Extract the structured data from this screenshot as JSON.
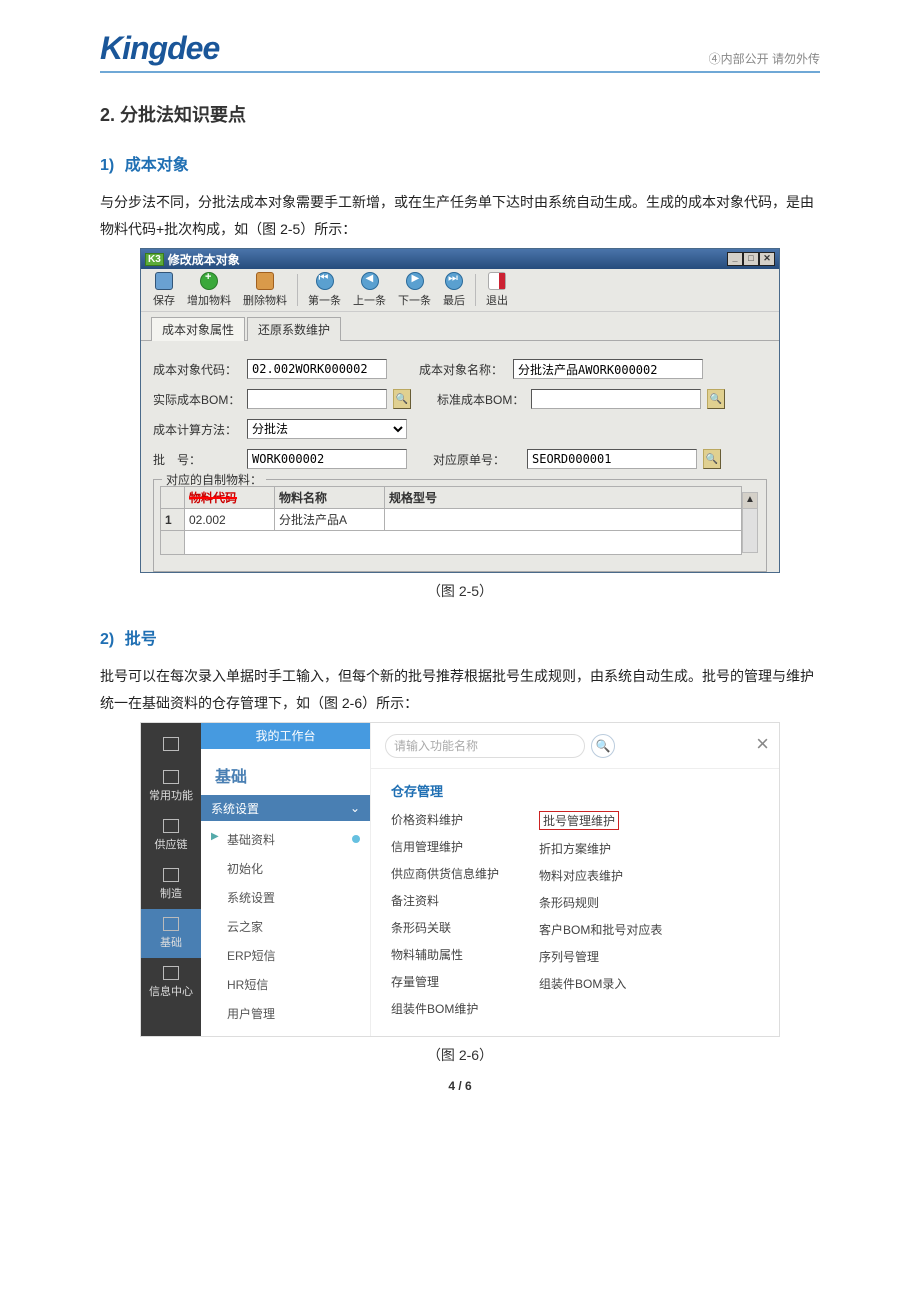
{
  "header": {
    "logo": "Kingdee",
    "confidential": "④内部公开 请勿外传"
  },
  "section": {
    "num": "2.",
    "title": "分批法知识要点"
  },
  "sub1": {
    "num": "1)",
    "title": "成本对象",
    "para": "与分步法不同，分批法成本对象需要手工新增，或在生产任务单下达时由系统自动生成。生成的成本对象代码，是由物料代码+批次构成，如（图 2-5）所示："
  },
  "fig25": {
    "caption": "（图 2-5）",
    "window_title": "修改成本对象",
    "k3": "K3",
    "winbtns": {
      "min": "_",
      "max": "□",
      "close": "✕"
    },
    "toolbar": {
      "save": "保存",
      "add": "增加物料",
      "del": "删除物料",
      "first": "第一条",
      "prev": "上一条",
      "next": "下一条",
      "last": "最后",
      "exit": "退出"
    },
    "tabs": {
      "t1": "成本对象属性",
      "t2": "还原系数维护"
    },
    "form": {
      "code_label": "成本对象代码：",
      "code_value": "02.002WORK000002",
      "name_label": "成本对象名称：",
      "name_value": "分批法产品AWORK000002",
      "realbom_label": "实际成本BOM：",
      "realbom_value": "",
      "stdbom_label": "标准成本BOM：",
      "stdbom_value": "",
      "method_label": "成本计算方法：",
      "method_value": "分批法",
      "batch_label": "批　号：",
      "batch_value": "WORK000002",
      "order_label": "对应原单号：",
      "order_value": "SEORD000001"
    },
    "fieldset_title": "对应的自制物料：",
    "grid": {
      "headers": {
        "code": "物料代码",
        "name": "物料名称",
        "spec": "规格型号"
      },
      "row": {
        "idx": "1",
        "code": "02.002",
        "name": "分批法产品A",
        "spec": ""
      }
    }
  },
  "sub2": {
    "num": "2)",
    "title": "批号",
    "para": "批号可以在每次录入单据时手工输入，但每个新的批号推荐根据批号生成规则，由系统自动生成。批号的管理与维护统一在基础资料的仓存管理下，如（图 2-6）所示："
  },
  "fig26": {
    "caption": "（图 2-6）",
    "rail": {
      "edit": "",
      "fav": "常用功能",
      "scm": "供应链",
      "mfg": "制造",
      "base": "基础",
      "msg": "信息中心"
    },
    "side": {
      "workspace": "我的工作台",
      "section": "基础",
      "panel": "系统设置",
      "items": [
        "基础资料",
        "初始化",
        "系统设置",
        "云之家",
        "ERP短信",
        "HR短信",
        "用户管理"
      ]
    },
    "main": {
      "search_placeholder": "请输入功能名称",
      "group_title": "仓存管理",
      "col1": [
        "价格资料维护",
        "信用管理维护",
        "供应商供货信息维护",
        "备注资料",
        "条形码关联",
        "物料辅助属性",
        "存量管理",
        "组装件BOM维护"
      ],
      "col2": [
        "批号管理维护",
        "折扣方案维护",
        "物料对应表维护",
        "条形码规则",
        "客户BOM和批号对应表",
        "序列号管理",
        "组装件BOM录入"
      ]
    }
  },
  "page_num": "4 / 6"
}
